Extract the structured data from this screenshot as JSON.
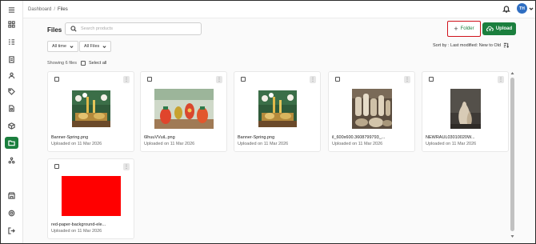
{
  "breadcrumb": {
    "root": "Dashboard",
    "separator": "/",
    "current": "Files"
  },
  "user": {
    "initials": "TH"
  },
  "page": {
    "title": "Files"
  },
  "search": {
    "placeholder": "Search products"
  },
  "toolbar": {
    "folder_label": "Folder",
    "upload_label": "Upload"
  },
  "filters": {
    "time": "All time",
    "type": "All Files"
  },
  "sort": {
    "label": "Sort by : Last modified: New to Old"
  },
  "summary": {
    "count_text": "Showing 6 files",
    "select_all": "Select all"
  },
  "files": [
    {
      "name": "Banner-Spring.png",
      "date": "Uploaded on 11 Mar 2026"
    },
    {
      "name": "6lhuuVVuiL.png",
      "date": "Uploaded on 11 Mar 2026"
    },
    {
      "name": "Banner-Spring.png",
      "date": "Uploaded on 11 Mar 2026"
    },
    {
      "name": "il_600x600.3608799793_...",
      "date": "Uploaded on 11 Mar 2026"
    },
    {
      "name": "NEWRAUL03010020W...",
      "date": "Uploaded on 11 Mar 2026"
    },
    {
      "name": "red-paper-background-ele...",
      "date": "Uploaded on 11 Mar 2026"
    }
  ],
  "colors": {
    "accent": "#1b7f3e",
    "highlight": "#d0121b",
    "avatar": "#2f6ec2",
    "red_image": "#ff0000"
  },
  "icons": {
    "sidebar": [
      "menu-icon",
      "dashboard-icon",
      "list-icon",
      "document-icon",
      "user-icon",
      "tags-icon",
      "file-settings-icon",
      "folder-icon",
      "network-icon",
      "store-icon",
      "settings-icon",
      "logout-icon"
    ],
    "topbar": [
      "bell-icon",
      "chevron-down-icon"
    ]
  }
}
